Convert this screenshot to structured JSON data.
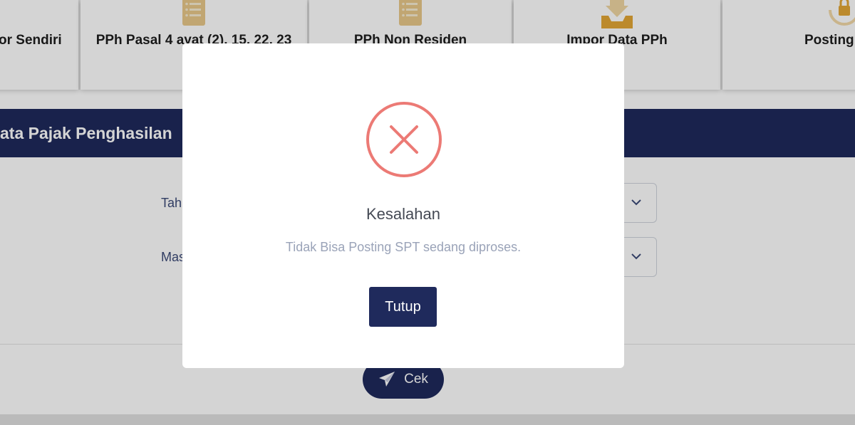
{
  "menu": {
    "items": [
      {
        "label": "or Sendiri",
        "icon": "document-list-icon"
      },
      {
        "label": "PPh Pasal 4 ayat (2), 15, 22, 23",
        "icon": "document-list-icon"
      },
      {
        "label": "PPh Non Residen",
        "icon": "document-list-icon"
      },
      {
        "label": "Impor Data PPh",
        "icon": "import-tray-icon"
      },
      {
        "label": "Posting",
        "icon": "lock-refresh-icon"
      }
    ]
  },
  "section": {
    "title": "ata Pajak Penghasilan"
  },
  "form": {
    "year_label": "Tah",
    "period_label": "Mas"
  },
  "footer": {
    "check_label": "Cek"
  },
  "dialog": {
    "title": "Kesalahan",
    "message": "Tidak Bisa Posting SPT sedang diproses.",
    "close_label": "Tutup"
  },
  "colors": {
    "primary": "#1f2a5c",
    "error": "#ec7a75",
    "icon_gold": "#e8b04a"
  }
}
